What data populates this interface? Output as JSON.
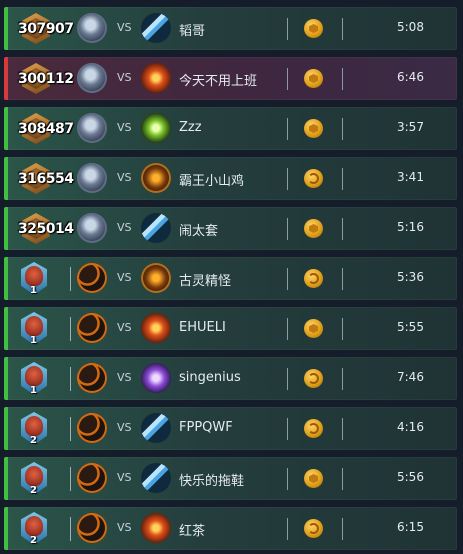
{
  "matches": [
    {
      "rank_type": "mmr",
      "mmr": "307907",
      "rank_number": "",
      "result": "win",
      "hero_avatar": "sword-hero-icon",
      "hero_style": "av-sword",
      "vs_label": "VS",
      "opponent_avatar": "blade-hero-icon",
      "opp_style": "av-blade",
      "opponent": "韬哥",
      "mode_icon": "hex-mode-icon",
      "duration": "5:08"
    },
    {
      "rank_type": "mmr",
      "mmr": "300112",
      "rank_number": "",
      "result": "loss",
      "hero_avatar": "sword-hero-icon",
      "hero_style": "av-sword",
      "vs_label": "VS",
      "opponent_avatar": "fire-hero-icon",
      "opp_style": "av-fire",
      "opponent": "今天不用上班",
      "mode_icon": "hex-mode-icon",
      "duration": "6:46"
    },
    {
      "rank_type": "mmr",
      "mmr": "308487",
      "rank_number": "",
      "result": "win",
      "hero_avatar": "sword-hero-icon",
      "hero_style": "av-sword",
      "vs_label": "VS",
      "opponent_avatar": "nature-hero-icon",
      "opp_style": "av-green",
      "opponent": "Zzz",
      "mode_icon": "hex-mode-icon",
      "duration": "3:57"
    },
    {
      "rank_type": "mmr",
      "mmr": "316554",
      "rank_number": "",
      "result": "win",
      "hero_avatar": "sword-hero-icon",
      "hero_style": "av-sword",
      "vs_label": "VS",
      "opponent_avatar": "warlord-hero-icon",
      "opp_style": "av-gold",
      "opponent": "霸王小山鸡",
      "mode_icon": "swirl-mode-icon",
      "duration": "3:41"
    },
    {
      "rank_type": "mmr",
      "mmr": "325014",
      "rank_number": "",
      "result": "win",
      "hero_avatar": "sword-hero-icon",
      "hero_style": "av-sword",
      "vs_label": "VS",
      "opponent_avatar": "blade-hero-icon",
      "opp_style": "av-blade",
      "opponent": "闹太套",
      "mode_icon": "hex-mode-icon",
      "duration": "5:16"
    },
    {
      "rank_type": "rank",
      "mmr": "",
      "rank_number": "1",
      "result": "win",
      "hero_avatar": "dark-hero-icon",
      "hero_style": "av-orange",
      "vs_label": "VS",
      "opponent_avatar": "warlord-hero-icon",
      "opp_style": "av-gold",
      "opponent": "古灵精怪",
      "mode_icon": "swirl-mode-icon",
      "duration": "5:36"
    },
    {
      "rank_type": "rank",
      "mmr": "",
      "rank_number": "1",
      "result": "win",
      "hero_avatar": "dark-hero-icon",
      "hero_style": "av-orange",
      "vs_label": "VS",
      "opponent_avatar": "fire-hero-icon",
      "opp_style": "av-fire",
      "opponent": "EHUELI",
      "mode_icon": "hex-mode-icon",
      "duration": "5:55"
    },
    {
      "rank_type": "rank",
      "mmr": "",
      "rank_number": "1",
      "result": "win",
      "hero_avatar": "dark-hero-icon",
      "hero_style": "av-orange",
      "vs_label": "VS",
      "opponent_avatar": "arcane-hero-icon",
      "opp_style": "av-purple",
      "opponent": "singenius",
      "mode_icon": "swirl-mode-icon",
      "duration": "7:46"
    },
    {
      "rank_type": "rank",
      "mmr": "",
      "rank_number": "2",
      "result": "win",
      "hero_avatar": "dark-hero-icon",
      "hero_style": "av-orange",
      "vs_label": "VS",
      "opponent_avatar": "blade-hero-icon",
      "opp_style": "av-blade",
      "opponent": "FPPQWF",
      "mode_icon": "swirl-mode-icon",
      "duration": "4:16"
    },
    {
      "rank_type": "rank",
      "mmr": "",
      "rank_number": "2",
      "result": "win",
      "hero_avatar": "dark-hero-icon",
      "hero_style": "av-orange",
      "vs_label": "VS",
      "opponent_avatar": "blade-hero-icon",
      "opp_style": "av-blade",
      "opponent": "快乐的拖鞋",
      "mode_icon": "hex-mode-icon",
      "duration": "5:56"
    },
    {
      "rank_type": "rank",
      "mmr": "",
      "rank_number": "2",
      "result": "win",
      "hero_avatar": "dark-hero-icon",
      "hero_style": "av-orange",
      "vs_label": "VS",
      "opponent_avatar": "fire-hero-icon",
      "opp_style": "av-fire",
      "opponent": "红茶",
      "mode_icon": "swirl-mode-icon",
      "duration": "6:15"
    }
  ],
  "colors": {
    "win": "#40c040",
    "loss": "#d63a3a",
    "accent": "#e0a018",
    "background": "#151d2b"
  }
}
